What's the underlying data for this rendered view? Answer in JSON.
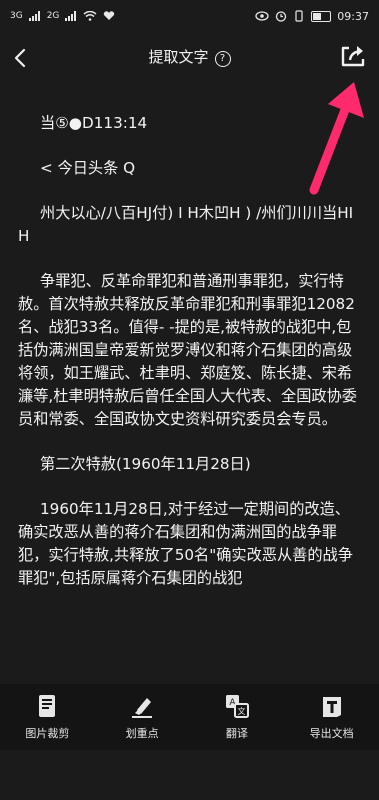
{
  "status_bar": {
    "signal1": "3G",
    "signal2": "2G",
    "time": "09:37"
  },
  "header": {
    "title": "提取文字",
    "help_glyph": "?"
  },
  "content": {
    "paragraphs": [
      "当⑤●D113:14",
      "< 今日头条 Q",
      "州大以心/八百HJ付) I H木凹H ) /州们川川当HI H",
      "争罪犯、反革命罪犯和普通刑事罪犯，实行特赦。首次特赦共释放反革命罪犯和刑事罪犯12082名、战犯33名。值得- -提的是,被特赦的战犯中,包括伪满洲国皇帝爱新觉罗溥仪和蒋介石集团的高级将领，如王耀武、杜聿明、郑庭笈、陈长捷、宋希濂等,杜聿明特赦后曾任全国人大代表、全国政协委员和常委、全国政协文史资料研究委员会专员。",
      "第二次特赦(1960年11月28日)",
      "1960年11月28日,对于经过一定期间的改造、确实改恶从善的蒋介石集团和伪满洲国的战争罪犯，实行特赦,共释放了50名\"确实改恶从善的战争罪犯\",包括原属蒋介石集团的战犯"
    ]
  },
  "toolbar": {
    "items": [
      {
        "label": "图片裁剪",
        "icon": "image-crop-icon"
      },
      {
        "label": "划重点",
        "icon": "highlighter-icon"
      },
      {
        "label": "翻译",
        "icon": "translate-icon"
      },
      {
        "label": "导出文档",
        "icon": "export-document-icon"
      }
    ]
  },
  "colors": {
    "background": "#1b1b1b",
    "toolbar": "#141414",
    "text": "#f2f2f2",
    "arrow": "#ff2a6d"
  }
}
